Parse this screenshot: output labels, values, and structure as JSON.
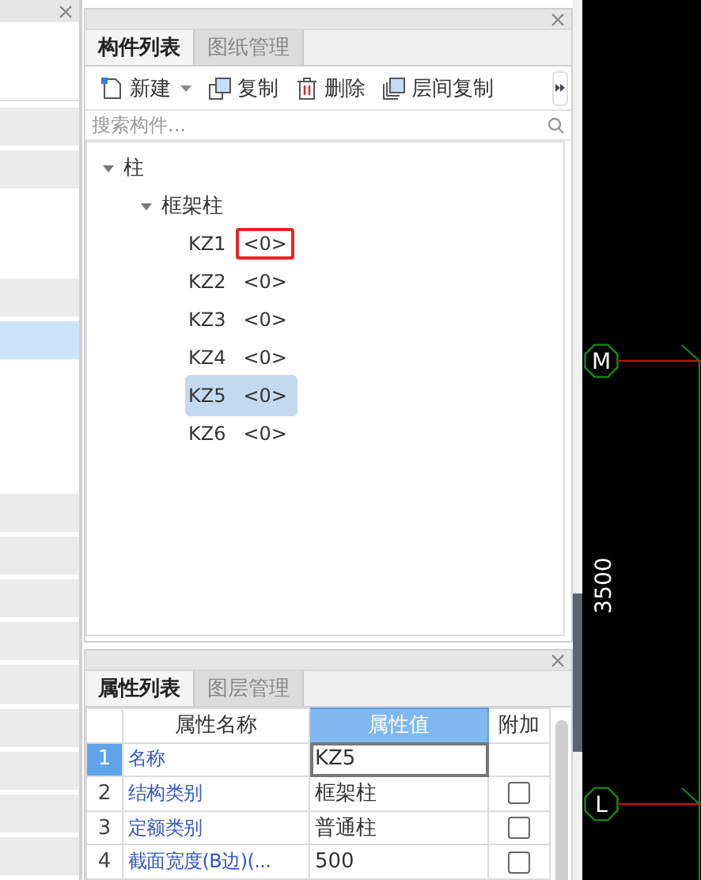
{
  "left_panel": {
    "rows": [
      {
        "kind": "shaded"
      },
      {
        "kind": "shaded"
      },
      {
        "kind": "blank"
      },
      {
        "kind": "blank"
      },
      {
        "kind": "shaded"
      },
      {
        "kind": "highlighted"
      },
      {
        "kind": "blank"
      },
      {
        "kind": "blank"
      },
      {
        "kind": "blank"
      },
      {
        "kind": "shaded"
      },
      {
        "kind": "shaded"
      },
      {
        "kind": "shaded"
      },
      {
        "kind": "shaded"
      },
      {
        "kind": "shaded"
      },
      {
        "kind": "shaded"
      },
      {
        "kind": "shaded"
      },
      {
        "kind": "shaded"
      },
      {
        "kind": "shaded"
      }
    ]
  },
  "component_panel": {
    "tabs": [
      {
        "label": "构件列表",
        "selected": true
      },
      {
        "label": "图纸管理",
        "selected": false
      }
    ],
    "toolbar": [
      {
        "kind": "new",
        "label": "新建",
        "dropdown": true
      },
      {
        "kind": "copy",
        "label": "复制",
        "dropdown": false
      },
      {
        "kind": "delete",
        "label": "删除",
        "dropdown": false
      },
      {
        "kind": "floor-copy",
        "label": "层间复制",
        "dropdown": false
      }
    ],
    "search": {
      "placeholder": "搜索构件..."
    },
    "tree": [
      {
        "label": "柱",
        "expanded": true,
        "children": [
          {
            "label": "框架柱",
            "expanded": true,
            "children": [
              {
                "label": "KZ1",
                "count": "<0>",
                "selected": false,
                "highlighted": true
              },
              {
                "label": "KZ2",
                "count": "<0>",
                "selected": false,
                "highlighted": false
              },
              {
                "label": "KZ3",
                "count": "<0>",
                "selected": false,
                "highlighted": false
              },
              {
                "label": "KZ4",
                "count": "<0>",
                "selected": false,
                "highlighted": false
              },
              {
                "label": "KZ5",
                "count": "<0>",
                "selected": true,
                "highlighted": false
              },
              {
                "label": "KZ6",
                "count": "<0>",
                "selected": false,
                "highlighted": false
              }
            ]
          }
        ]
      }
    ]
  },
  "property_panel": {
    "tabs": [
      {
        "label": "属性列表",
        "selected": true
      },
      {
        "label": "图层管理",
        "selected": false
      }
    ],
    "columns": [
      "属性名称",
      "属性值",
      "附加"
    ],
    "rows": [
      {
        "index": "1",
        "name": "名称",
        "value": "KZ5",
        "selected": true,
        "kind": "plain"
      },
      {
        "index": "2",
        "name": "结构类别",
        "value": "框架柱",
        "selected": false,
        "kind": "checkbox",
        "checked": false
      },
      {
        "index": "3",
        "name": "定额类别",
        "value": "普通柱",
        "selected": false,
        "kind": "checkbox",
        "checked": false
      },
      {
        "index": "4",
        "name": "截面宽度(B边)(...",
        "value": "500",
        "selected": false,
        "kind": "checkbox",
        "checked": false
      }
    ]
  },
  "canvas": {
    "axes": [
      {
        "label": "M"
      },
      {
        "label": "L"
      }
    ],
    "dimension": "3500"
  }
}
